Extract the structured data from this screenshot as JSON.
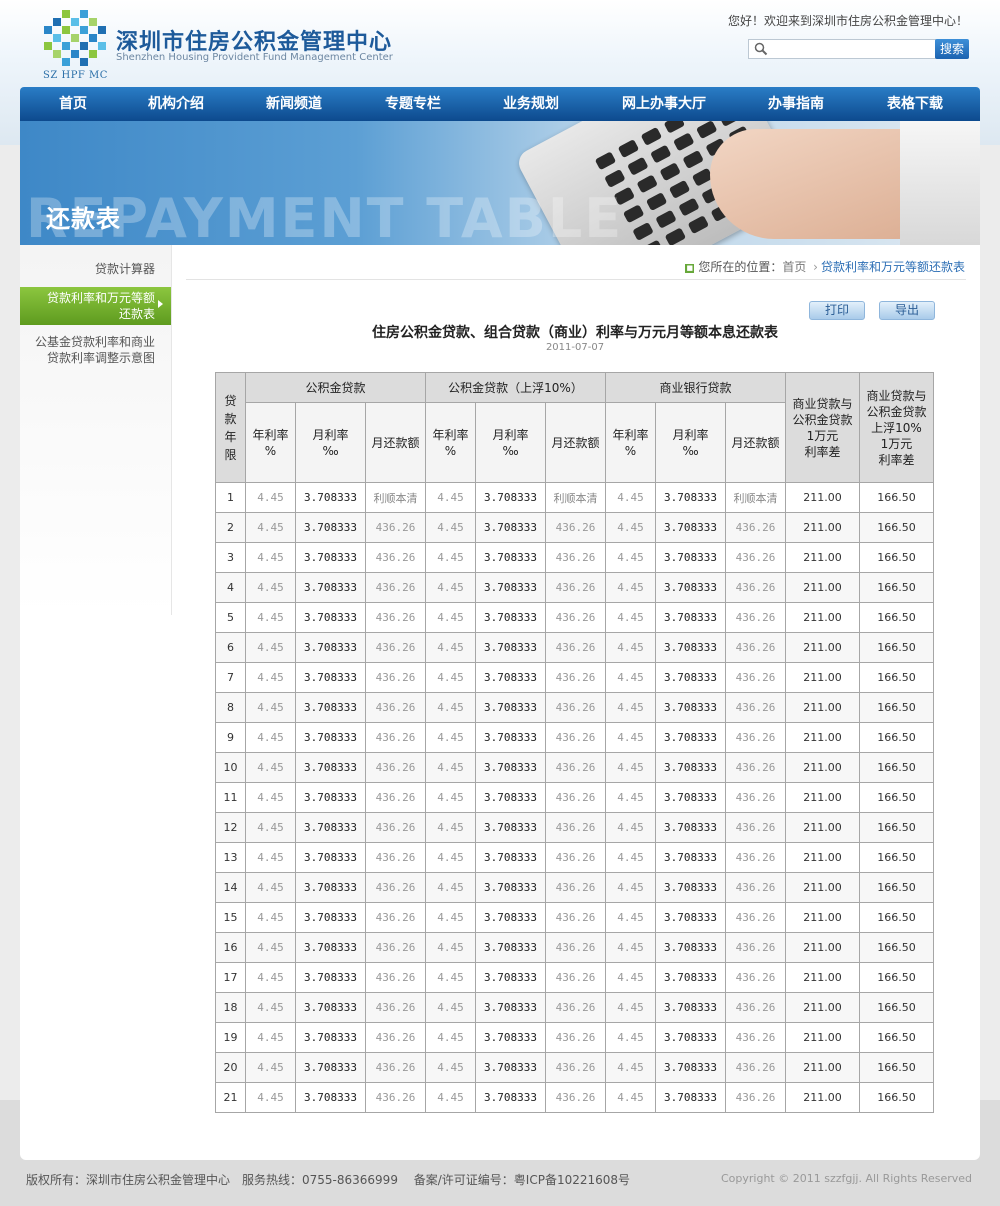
{
  "header": {
    "logo_abbr": "SZ HPF MC",
    "site_name": "深圳市住房公积金管理中心",
    "site_name_en": "Shenzhen Housing Provident Fund Management Center",
    "welcome": "您好！欢迎来到深圳市住房公积金管理中心！",
    "search_placeholder": "",
    "search_button": "搜索"
  },
  "nav": [
    "首页",
    "机构介绍",
    "新闻频道",
    "专题专栏",
    "业务规划",
    "网上办事大厅",
    "办事指南",
    "表格下载"
  ],
  "banner": {
    "title": "还款表",
    "watermark": "REPAYMENT TABLE"
  },
  "sidebar": {
    "items": [
      {
        "label": "贷款计算器"
      },
      {
        "label": "贷款利率和万元等额还款表",
        "line1": "贷款利率和万元等额",
        "line2": "还款表",
        "active": true
      },
      {
        "label": "公基金贷款利率和商业贷款利率调整示意图",
        "line1": "公基金贷款利率和商业",
        "line2": "贷款利率调整示意图"
      }
    ]
  },
  "breadcrumb": {
    "prefix": "您所在的位置：",
    "home": "首页",
    "current": "贷款利率和万元等额还款表"
  },
  "actions": {
    "print": "打印",
    "export": "导出"
  },
  "document": {
    "title": "住房公积金贷款、组合贷款（商业）利率与万元月等额本息还款表",
    "date": "2011-07-07"
  },
  "table": {
    "col_term": "贷款年限",
    "group_headers": [
      "公积金贷款",
      "公积金贷款（上浮10%）",
      "商业银行贷款"
    ],
    "sub_headers": [
      {
        "line1": "年利率",
        "line2": "%"
      },
      {
        "line1": "月利率",
        "line2": "‰"
      },
      {
        "line1": "月还款额",
        "line2": ""
      }
    ],
    "diff_header_1": [
      "商业贷款与",
      "公积金贷款",
      "1万元",
      "利率差"
    ],
    "diff_header_2": [
      "商业贷款与",
      "公积金贷款",
      "上浮10%",
      "1万元",
      "利率差"
    ],
    "rows": [
      [
        "1",
        "4.45",
        "3.708333",
        "利顺本清",
        "4.45",
        "3.708333",
        "利顺本清",
        "4.45",
        "3.708333",
        "利顺本清",
        "211.00",
        "166.50"
      ],
      [
        "2",
        "4.45",
        "3.708333",
        "436.26",
        "4.45",
        "3.708333",
        "436.26",
        "4.45",
        "3.708333",
        "436.26",
        "211.00",
        "166.50"
      ],
      [
        "3",
        "4.45",
        "3.708333",
        "436.26",
        "4.45",
        "3.708333",
        "436.26",
        "4.45",
        "3.708333",
        "436.26",
        "211.00",
        "166.50"
      ],
      [
        "4",
        "4.45",
        "3.708333",
        "436.26",
        "4.45",
        "3.708333",
        "436.26",
        "4.45",
        "3.708333",
        "436.26",
        "211.00",
        "166.50"
      ],
      [
        "5",
        "4.45",
        "3.708333",
        "436.26",
        "4.45",
        "3.708333",
        "436.26",
        "4.45",
        "3.708333",
        "436.26",
        "211.00",
        "166.50"
      ],
      [
        "6",
        "4.45",
        "3.708333",
        "436.26",
        "4.45",
        "3.708333",
        "436.26",
        "4.45",
        "3.708333",
        "436.26",
        "211.00",
        "166.50"
      ],
      [
        "7",
        "4.45",
        "3.708333",
        "436.26",
        "4.45",
        "3.708333",
        "436.26",
        "4.45",
        "3.708333",
        "436.26",
        "211.00",
        "166.50"
      ],
      [
        "8",
        "4.45",
        "3.708333",
        "436.26",
        "4.45",
        "3.708333",
        "436.26",
        "4.45",
        "3.708333",
        "436.26",
        "211.00",
        "166.50"
      ],
      [
        "9",
        "4.45",
        "3.708333",
        "436.26",
        "4.45",
        "3.708333",
        "436.26",
        "4.45",
        "3.708333",
        "436.26",
        "211.00",
        "166.50"
      ],
      [
        "10",
        "4.45",
        "3.708333",
        "436.26",
        "4.45",
        "3.708333",
        "436.26",
        "4.45",
        "3.708333",
        "436.26",
        "211.00",
        "166.50"
      ],
      [
        "11",
        "4.45",
        "3.708333",
        "436.26",
        "4.45",
        "3.708333",
        "436.26",
        "4.45",
        "3.708333",
        "436.26",
        "211.00",
        "166.50"
      ],
      [
        "12",
        "4.45",
        "3.708333",
        "436.26",
        "4.45",
        "3.708333",
        "436.26",
        "4.45",
        "3.708333",
        "436.26",
        "211.00",
        "166.50"
      ],
      [
        "13",
        "4.45",
        "3.708333",
        "436.26",
        "4.45",
        "3.708333",
        "436.26",
        "4.45",
        "3.708333",
        "436.26",
        "211.00",
        "166.50"
      ],
      [
        "14",
        "4.45",
        "3.708333",
        "436.26",
        "4.45",
        "3.708333",
        "436.26",
        "4.45",
        "3.708333",
        "436.26",
        "211.00",
        "166.50"
      ],
      [
        "15",
        "4.45",
        "3.708333",
        "436.26",
        "4.45",
        "3.708333",
        "436.26",
        "4.45",
        "3.708333",
        "436.26",
        "211.00",
        "166.50"
      ],
      [
        "16",
        "4.45",
        "3.708333",
        "436.26",
        "4.45",
        "3.708333",
        "436.26",
        "4.45",
        "3.708333",
        "436.26",
        "211.00",
        "166.50"
      ],
      [
        "17",
        "4.45",
        "3.708333",
        "436.26",
        "4.45",
        "3.708333",
        "436.26",
        "4.45",
        "3.708333",
        "436.26",
        "211.00",
        "166.50"
      ],
      [
        "18",
        "4.45",
        "3.708333",
        "436.26",
        "4.45",
        "3.708333",
        "436.26",
        "4.45",
        "3.708333",
        "436.26",
        "211.00",
        "166.50"
      ],
      [
        "19",
        "4.45",
        "3.708333",
        "436.26",
        "4.45",
        "3.708333",
        "436.26",
        "4.45",
        "3.708333",
        "436.26",
        "211.00",
        "166.50"
      ],
      [
        "20",
        "4.45",
        "3.708333",
        "436.26",
        "4.45",
        "3.708333",
        "436.26",
        "4.45",
        "3.708333",
        "436.26",
        "211.00",
        "166.50"
      ],
      [
        "21",
        "4.45",
        "3.708333",
        "436.26",
        "4.45",
        "3.708333",
        "436.26",
        "4.45",
        "3.708333",
        "436.26",
        "211.00",
        "166.50"
      ]
    ]
  },
  "footer": {
    "left": "版权所有：深圳市住房公积金管理中心　服务热线：0755-86366999　 备案/许可证编号：粤ICP备10221608号",
    "right": "Copyright © 2011 szzfgjj. All Rights Reserved"
  },
  "colors": {
    "nav_blue": "#0d4a8e",
    "active_green": "#6aa82a",
    "link_blue": "#2d6fb5"
  },
  "icons": [
    "logo-mosaic",
    "search-icon",
    "arrow-right-icon",
    "home-square-icon",
    "chevron-right-icon"
  ]
}
